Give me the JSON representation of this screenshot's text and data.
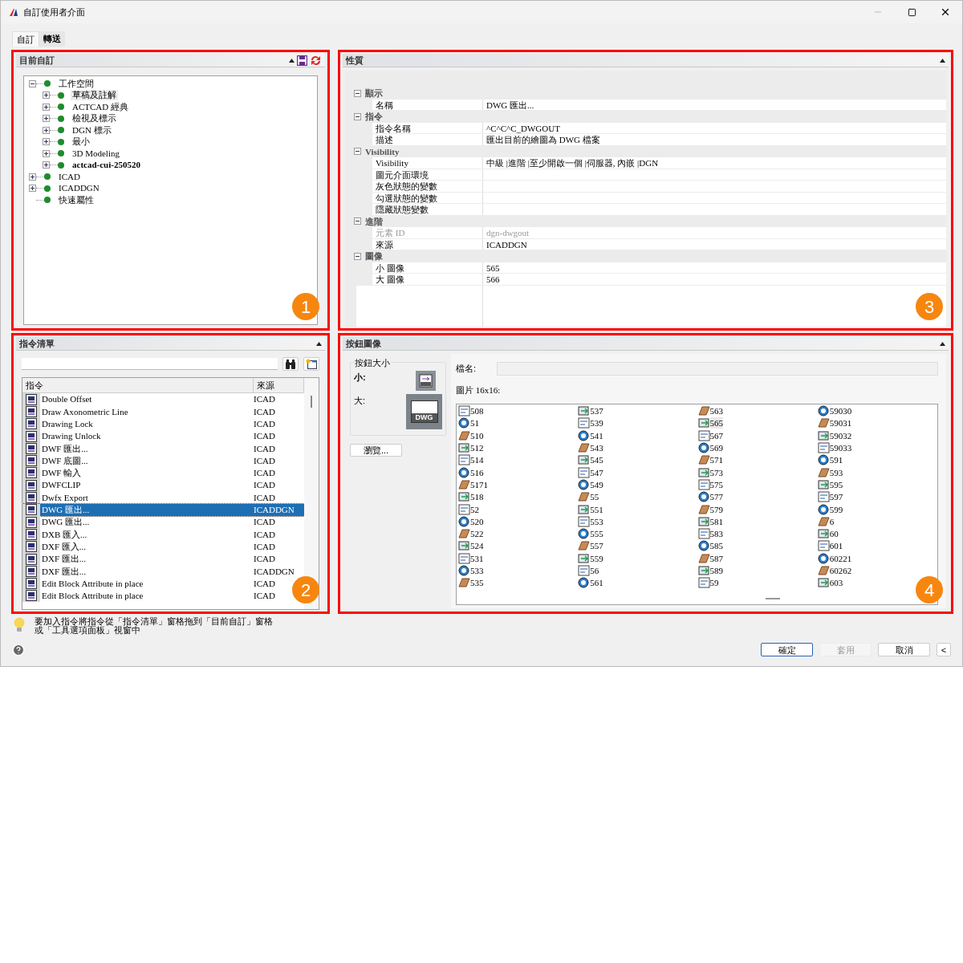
{
  "window": {
    "title": "自訂使用者介面"
  },
  "tabs": [
    {
      "label": "自訂",
      "selected": true
    },
    {
      "label": "轉送",
      "selected": false
    }
  ],
  "current_customization": {
    "title": "目前自訂",
    "badge": "1",
    "tree": [
      {
        "label": "工作空間",
        "expanded": true,
        "bold": false,
        "selected": false,
        "children": [
          {
            "label": "草稿及註解",
            "expanded": false,
            "bold": false,
            "selected": true
          },
          {
            "label": "ACTCAD 經典",
            "expanded": false,
            "bold": false,
            "selected": false
          },
          {
            "label": "檢視及標示",
            "expanded": false,
            "bold": false,
            "selected": false
          },
          {
            "label": "DGN 標示",
            "expanded": false,
            "bold": false,
            "selected": false
          },
          {
            "label": "最小",
            "expanded": false,
            "bold": false,
            "selected": false
          },
          {
            "label": "3D Modeling",
            "expanded": false,
            "bold": false,
            "selected": false
          },
          {
            "label": "actcad-cui-250520",
            "expanded": false,
            "bold": true,
            "selected": false
          }
        ]
      },
      {
        "label": "ICAD",
        "expanded": false,
        "bold": false,
        "selected": false
      },
      {
        "label": "ICADDGN",
        "expanded": false,
        "bold": false,
        "selected": false
      },
      {
        "label": "快速屬性",
        "bold": false,
        "selected": false
      }
    ]
  },
  "properties": {
    "title": "性質",
    "badge": "3",
    "sections": [
      {
        "label": "顯示",
        "expanded": true,
        "rows": [
          {
            "label": "名稱",
            "value": "DWG 匯出...",
            "disabled": false
          }
        ]
      },
      {
        "label": "指令",
        "expanded": true,
        "rows": [
          {
            "label": "指令名稱",
            "value": "^C^C^C_DWGOUT",
            "disabled": false
          },
          {
            "label": "描述",
            "value": "匯出目前的繪圖為 DWG 檔案",
            "disabled": false
          }
        ]
      },
      {
        "label": "Visibility",
        "expanded": true,
        "rows": [
          {
            "label": "Visibility",
            "value": "中級 |進階 |至少開啟一個 |伺服器, 內嵌 |DGN",
            "disabled": false
          },
          {
            "label": "圖元介面環境",
            "disabled": false
          },
          {
            "label": "灰色狀態的變數",
            "disabled": false
          },
          {
            "label": "勾選狀態的變數",
            "disabled": false
          },
          {
            "label": "隱藏狀態變數",
            "disabled": false
          }
        ]
      },
      {
        "label": "進階",
        "expanded": true,
        "rows": [
          {
            "label": "元素 ID",
            "value": "dgn-dwgout",
            "disabled": true
          },
          {
            "label": "來源",
            "value": "ICADDGN",
            "disabled": false
          }
        ]
      },
      {
        "label": "圖像",
        "expanded": true,
        "rows": [
          {
            "label": "小 圖像",
            "value": "565",
            "disabled": false
          },
          {
            "label": "大 圖像",
            "value": "566",
            "disabled": false
          }
        ]
      }
    ]
  },
  "command_list": {
    "title": "指令清單",
    "badge": "2",
    "columns": [
      "指令",
      "來源"
    ],
    "rows": [
      {
        "name": "Double Offset",
        "source": "ICAD",
        "selected": false
      },
      {
        "name": "Draw Axonometric Line",
        "source": "ICAD",
        "selected": false
      },
      {
        "name": "Drawing Lock",
        "source": "ICAD",
        "selected": false
      },
      {
        "name": "Drawing Unlock",
        "source": "ICAD",
        "selected": false
      },
      {
        "name": "DWF 匯出...",
        "source": "ICAD",
        "selected": false
      },
      {
        "name": "DWF 底圖...",
        "source": "ICAD",
        "selected": false
      },
      {
        "name": "DWF 輸入",
        "source": "ICAD",
        "selected": false
      },
      {
        "name": "DWFCLIP",
        "source": "ICAD",
        "selected": false
      },
      {
        "name": "Dwfx Export",
        "source": "ICAD",
        "selected": false
      },
      {
        "name": "DWG 匯出...",
        "source": "ICADDGN",
        "selected": true
      },
      {
        "name": "DWG 匯出...",
        "source": "ICAD",
        "selected": false
      },
      {
        "name": "DXB 匯入...",
        "source": "ICAD",
        "selected": false
      },
      {
        "name": "DXF 匯入...",
        "source": "ICAD",
        "selected": false
      },
      {
        "name": "DXF 匯出...",
        "source": "ICAD",
        "selected": false
      },
      {
        "name": "DXF 匯出...",
        "source": "ICADDGN",
        "selected": false
      },
      {
        "name": "Edit Block Attribute in place",
        "source": "ICAD",
        "selected": false
      },
      {
        "name": "Edit Block Attribute in place",
        "source": "ICAD",
        "selected": false
      }
    ]
  },
  "button_image": {
    "title": "按鈕圖像",
    "badge": "4",
    "size_title": "按鈕大小",
    "small_label": "小:",
    "large_label": "大:",
    "large_icon_text": "DWG",
    "browse_button": "瀏覽...",
    "file_name_label": "檔名:",
    "image_label": "圖片 16x16:",
    "images": [
      {
        "label": "508",
        "selected": false
      },
      {
        "label": "51",
        "selected": false
      },
      {
        "label": "510",
        "selected": false
      },
      {
        "label": "512",
        "selected": false
      },
      {
        "label": "514",
        "selected": false
      },
      {
        "label": "516",
        "selected": false
      },
      {
        "label": "5171",
        "selected": false
      },
      {
        "label": "518",
        "selected": false
      },
      {
        "label": "52",
        "selected": false
      },
      {
        "label": "520",
        "selected": false
      },
      {
        "label": "522",
        "selected": false
      },
      {
        "label": "524",
        "selected": false
      },
      {
        "label": "531",
        "selected": false
      },
      {
        "label": "533",
        "selected": false
      },
      {
        "label": "535",
        "selected": false
      },
      {
        "label": "537",
        "selected": false
      },
      {
        "label": "539",
        "selected": false
      },
      {
        "label": "541",
        "selected": false
      },
      {
        "label": "543",
        "selected": false
      },
      {
        "label": "545",
        "selected": false
      },
      {
        "label": "547",
        "selected": false
      },
      {
        "label": "549",
        "selected": false
      },
      {
        "label": "55",
        "selected": false
      },
      {
        "label": "551",
        "selected": false
      },
      {
        "label": "553",
        "selected": false
      },
      {
        "label": "555",
        "selected": false
      },
      {
        "label": "557",
        "selected": false
      },
      {
        "label": "559",
        "selected": false
      },
      {
        "label": "56",
        "selected": false
      },
      {
        "label": "561",
        "selected": false
      },
      {
        "label": "563",
        "selected": false
      },
      {
        "label": "565",
        "selected": true
      },
      {
        "label": "567",
        "selected": false
      },
      {
        "label": "569",
        "selected": false
      },
      {
        "label": "571",
        "selected": false
      },
      {
        "label": "573",
        "selected": false
      },
      {
        "label": "575",
        "selected": false
      },
      {
        "label": "577",
        "selected": false
      },
      {
        "label": "579",
        "selected": false
      },
      {
        "label": "581",
        "selected": false
      },
      {
        "label": "583",
        "selected": false
      },
      {
        "label": "585",
        "selected": false
      },
      {
        "label": "587",
        "selected": false
      },
      {
        "label": "589",
        "selected": false
      },
      {
        "label": "59",
        "selected": false
      },
      {
        "label": "59030",
        "selected": false
      },
      {
        "label": "59031",
        "selected": false
      },
      {
        "label": "59032",
        "selected": false
      },
      {
        "label": "59033",
        "selected": false
      },
      {
        "label": "591",
        "selected": false
      },
      {
        "label": "593",
        "selected": false
      },
      {
        "label": "595",
        "selected": false
      },
      {
        "label": "597",
        "selected": false
      },
      {
        "label": "599",
        "selected": false
      },
      {
        "label": "6",
        "selected": false
      },
      {
        "label": "60",
        "selected": false
      },
      {
        "label": "601",
        "selected": false
      },
      {
        "label": "60221",
        "selected": false
      },
      {
        "label": "60262",
        "selected": false
      },
      {
        "label": "603",
        "selected": false
      }
    ]
  },
  "hint": "要加入指令將指令從「指令清單」窗格拖到「目前自訂」窗格或「工具選項面板」視窗中",
  "buttons": [
    {
      "label": "確定",
      "default": true,
      "disabled": false
    },
    {
      "label": "套用",
      "default": false,
      "disabled": true
    },
    {
      "label": "取消",
      "default": false,
      "disabled": false
    },
    {
      "label": "<",
      "default": false,
      "disabled": false
    }
  ]
}
